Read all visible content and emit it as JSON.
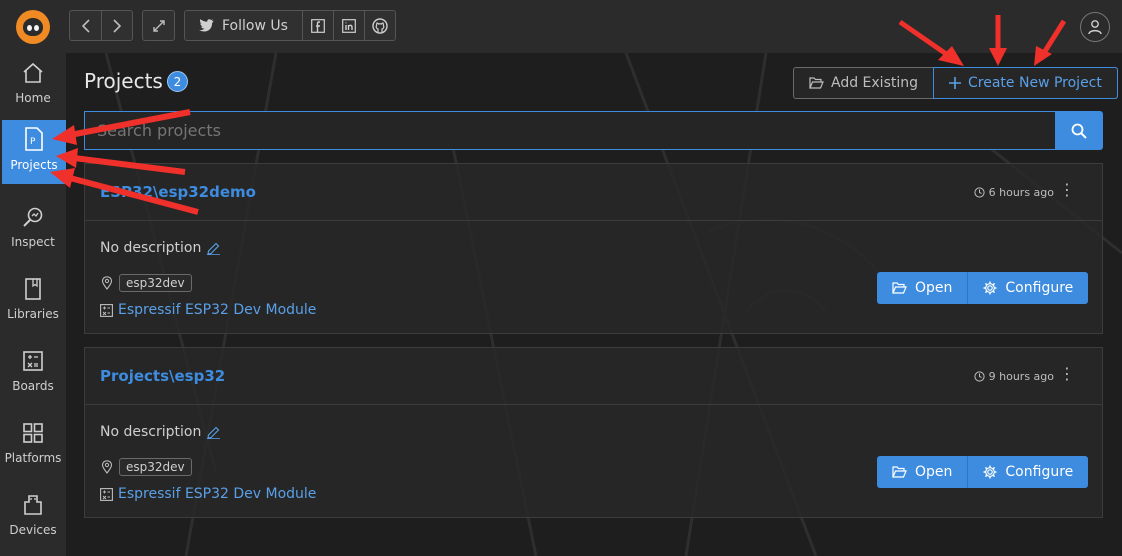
{
  "topbar": {
    "follow_label": "Follow Us",
    "icons": [
      "back-icon",
      "forward-icon",
      "expand-icon",
      "twitter-icon",
      "facebook-icon",
      "linkedin-icon",
      "github-icon",
      "user-icon"
    ]
  },
  "sidebar": {
    "items": [
      {
        "label": "Home",
        "icon": "home-icon"
      },
      {
        "label": "Projects",
        "icon": "projects-icon",
        "active": true
      },
      {
        "label": "Inspect",
        "icon": "inspect-icon"
      },
      {
        "label": "Libraries",
        "icon": "libraries-icon"
      },
      {
        "label": "Boards",
        "icon": "boards-icon"
      },
      {
        "label": "Platforms",
        "icon": "platforms-icon"
      },
      {
        "label": "Devices",
        "icon": "devices-icon"
      }
    ]
  },
  "main": {
    "title": "Projects",
    "count": "2",
    "add_existing_label": "Add Existing",
    "create_new_label": "Create New Project",
    "search_placeholder": "Search projects",
    "projects": [
      {
        "name": "ESP32\\esp32demo",
        "time": "6 hours ago",
        "description": "No description",
        "env": "esp32dev",
        "board": "Espressif ESP32 Dev Module",
        "open_label": "Open",
        "configure_label": "Configure"
      },
      {
        "name": "Projects\\esp32",
        "time": "9 hours ago",
        "description": "No description",
        "env": "esp32dev",
        "board": "Espressif ESP32 Dev Module",
        "open_label": "Open",
        "configure_label": "Configure"
      }
    ]
  },
  "colors": {
    "accent": "#3d8ce0",
    "brand": "#f08a24",
    "annotation_arrows": "#f0302a"
  }
}
